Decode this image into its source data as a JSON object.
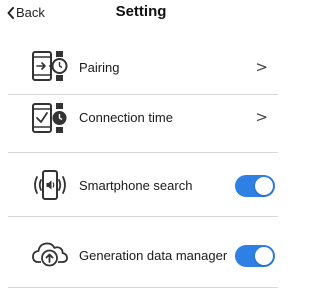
{
  "header": {
    "back_label": "Back",
    "title": "Setting"
  },
  "rows": [
    {
      "label": "Pairing",
      "icon": "phone-watch-pairing-icon",
      "control": "chevron",
      "chevron": ">"
    },
    {
      "label": "Connection time",
      "icon": "phone-watch-check-icon",
      "control": "chevron",
      "chevron": ">"
    },
    {
      "label": "Smartphone search",
      "icon": "phone-vibrate-icon",
      "control": "toggle",
      "on": true
    },
    {
      "label": "Generation data manager",
      "icon": "cloud-upload-icon",
      "control": "toggle",
      "on": true
    }
  ],
  "colors": {
    "toggle_on": "#2f80e5",
    "divider": "#d7d7d7"
  }
}
